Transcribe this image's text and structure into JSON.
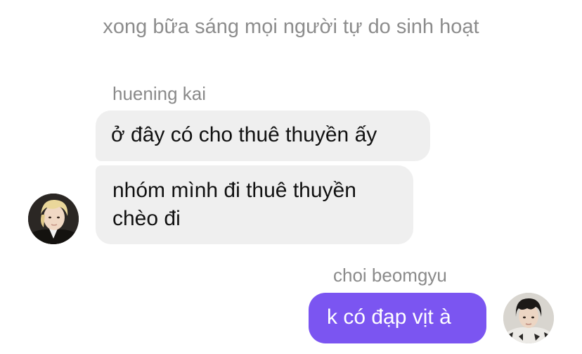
{
  "system_message": "xong bữa sáng mọi người tự do sinh hoạt",
  "messages": [
    {
      "sender": "huening kai",
      "bubbles": [
        "ở đây có cho thuê thuyền ấy",
        "nhóm mình đi thuê thuyền chèo đi"
      ]
    },
    {
      "sender": "choi beomgyu",
      "bubbles": [
        "k có đạp vịt à"
      ]
    }
  ],
  "colors": {
    "incoming_bubble": "#efefef",
    "outgoing_bubble": "#7b55f1",
    "sender_name": "#8a8a8a",
    "system_text": "#8c8c8c"
  }
}
